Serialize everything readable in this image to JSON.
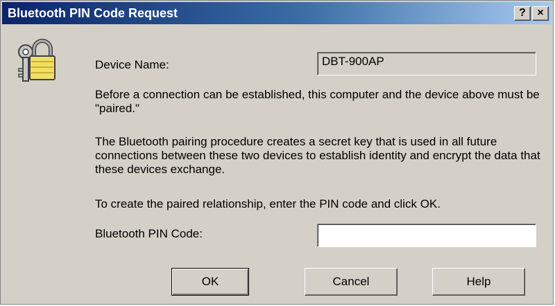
{
  "window": {
    "title": "Bluetooth PIN Code Request",
    "help_glyph": "?",
    "close_glyph": "×"
  },
  "icon": {
    "name": "lock-keys-icon"
  },
  "device": {
    "label": "Device Name:",
    "value": "DBT-900AP"
  },
  "paragraphs": {
    "p1": "Before a connection can be established, this computer and the device above must be \"paired.\"",
    "p2": "The Bluetooth pairing procedure creates a secret key that is used in all future connections between these two devices to establish identity and encrypt the data that these devices exchange.",
    "p3": "To create the paired relationship, enter the PIN code and click OK."
  },
  "pin": {
    "label": "Bluetooth PIN Code:",
    "value": ""
  },
  "buttons": {
    "ok": "OK",
    "cancel": "Cancel",
    "help": "Help"
  },
  "colors": {
    "title_bar_start": "#0a246a",
    "title_bar_end": "#a6caf0",
    "dialog_face": "#d4d0c8"
  }
}
